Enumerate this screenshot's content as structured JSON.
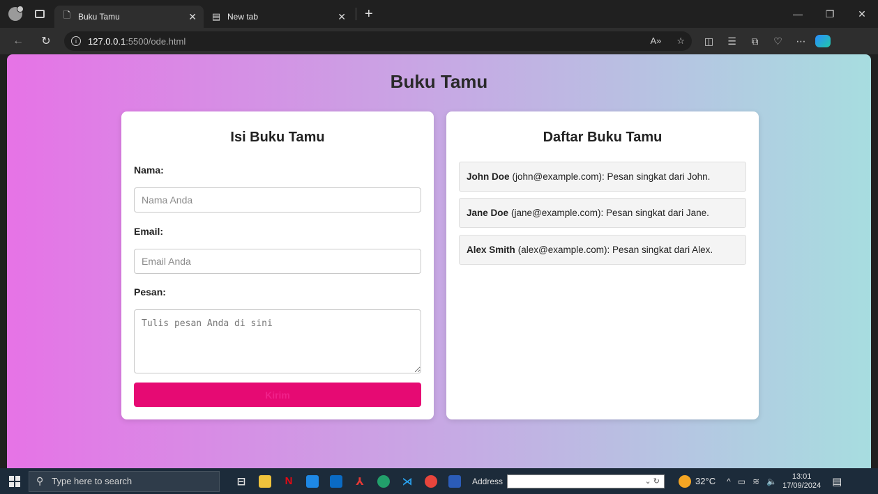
{
  "browser": {
    "tabs": [
      {
        "title": "Buku Tamu",
        "icon": "page-icon",
        "active": true
      },
      {
        "title": "New tab",
        "icon": "newtab-icon",
        "active": false
      }
    ],
    "url_host": "127.0.0.1",
    "url_rest": ":5500/ode.html"
  },
  "page": {
    "title": "Buku Tamu",
    "form": {
      "title": "Isi Buku Tamu",
      "name_label": "Nama:",
      "name_placeholder": "Nama Anda",
      "email_label": "Email:",
      "email_placeholder": "Email Anda",
      "message_label": "Pesan:",
      "message_placeholder": "Tulis pesan Anda di sini",
      "submit_label": "Kirim"
    },
    "list": {
      "title": "Daftar Buku Tamu",
      "entries": [
        {
          "name": "John Doe",
          "detail": "(john@example.com): Pesan singkat dari John."
        },
        {
          "name": "Jane Doe",
          "detail": "(jane@example.com): Pesan singkat dari Jane."
        },
        {
          "name": "Alex Smith",
          "detail": "(alex@example.com): Pesan singkat dari Alex."
        }
      ]
    }
  },
  "taskbar": {
    "search_placeholder": "Type here to search",
    "address_label": "Address",
    "temperature": "32°C",
    "time": "13:01",
    "date": "17/09/2024"
  },
  "colors": {
    "gradient_start": "#e673e6",
    "gradient_end": "#a7dde0",
    "submit_bg": "#e60a73"
  }
}
